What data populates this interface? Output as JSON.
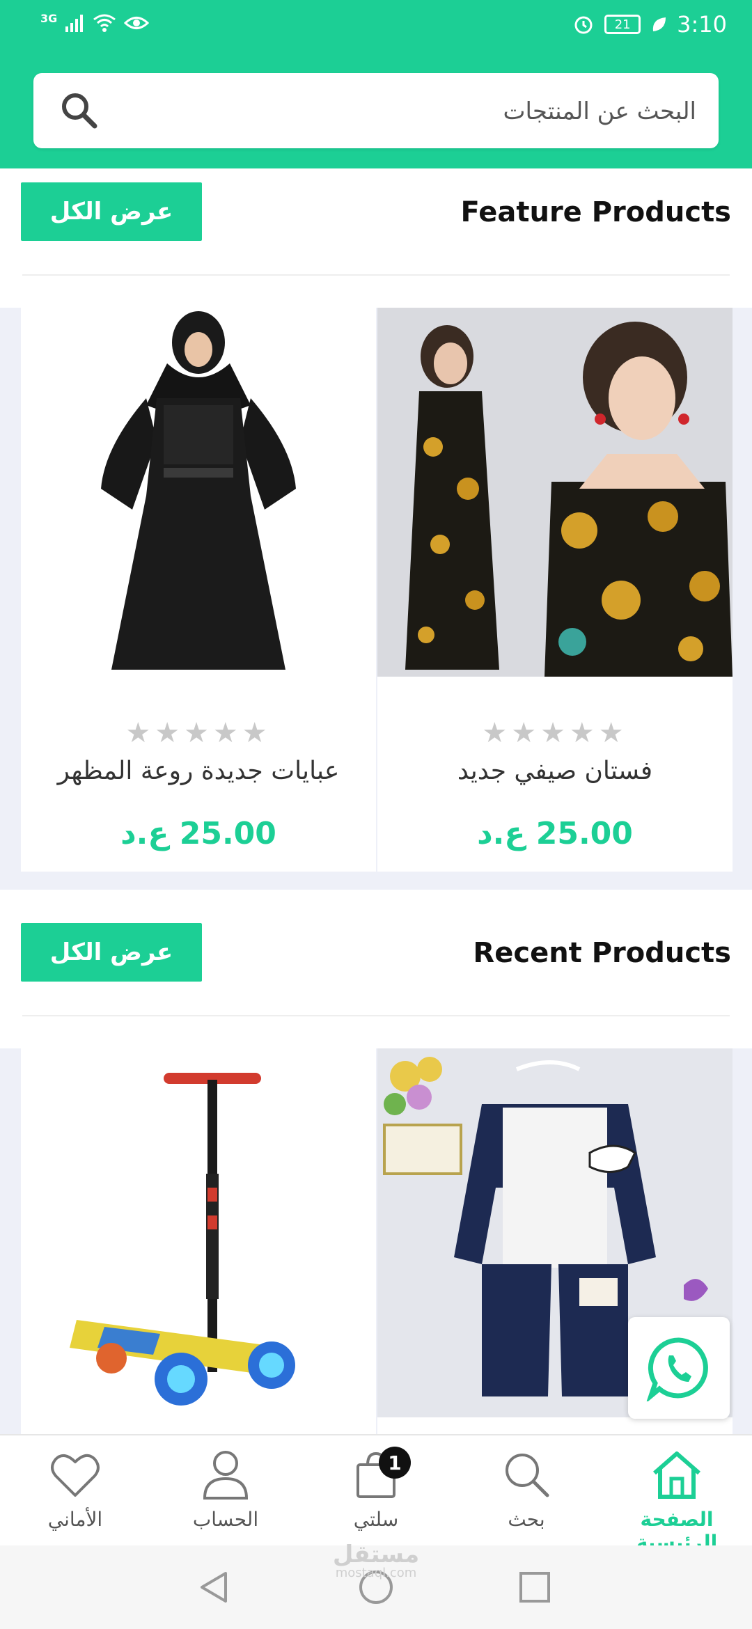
{
  "status_bar": {
    "network": "3G",
    "battery": "21",
    "time": "3:10"
  },
  "search": {
    "placeholder": "البحث عن المنتجات"
  },
  "colors": {
    "accent": "#1ccf95",
    "band": "#eef0f8"
  },
  "featured": {
    "title": "Feature Products",
    "view_all": "عرض الكل",
    "products": [
      {
        "name": "فستان صيفي جديد",
        "price": "25.00 ع.د",
        "rating": 0,
        "image": "patterned-wrap-dress"
      },
      {
        "name": "عبايات جديدة روعة المظهر",
        "price": "25.00 ع.د",
        "rating": 0,
        "image": "black-abaya"
      }
    ]
  },
  "recent": {
    "title": "Recent Products",
    "view_all": "عرض الكل",
    "products": [
      {
        "image": "kids-navy-tracksuit"
      },
      {
        "image": "kids-scooter"
      }
    ]
  },
  "bottom_nav": {
    "items": [
      {
        "label": "الصفحة الرئيسية",
        "icon": "home-icon",
        "active": true
      },
      {
        "label": "بحث",
        "icon": "search-icon"
      },
      {
        "label": "سلتي",
        "icon": "cart-icon",
        "badge": "1"
      },
      {
        "label": "الحساب",
        "icon": "user-icon"
      },
      {
        "label": "الأماني",
        "icon": "heart-icon"
      }
    ]
  },
  "watermark": {
    "main": "مستقل",
    "sub": "mostaql.com"
  }
}
